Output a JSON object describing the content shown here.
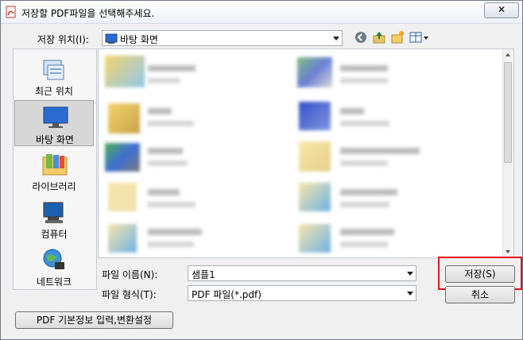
{
  "title": "저장할 PDF파일을 선택해주세요.",
  "close_glyph": "✕",
  "location": {
    "label": "저장 위치(I):",
    "value": "바탕 화면"
  },
  "places": [
    {
      "label": "최근 위치"
    },
    {
      "label": "바탕 화면"
    },
    {
      "label": "라이브러리"
    },
    {
      "label": "컴퓨터"
    },
    {
      "label": "네트워크"
    }
  ],
  "filename": {
    "label": "파일 이름(N):",
    "value": "샘플1"
  },
  "filetype": {
    "label": "파일 형식(T):",
    "value": "PDF 파일(*.pdf)"
  },
  "buttons": {
    "save": "저장(S)",
    "cancel": "취소",
    "pdf_settings": "PDF 기본정보 입력,변환설정"
  },
  "colors": {
    "highlight": "#e5141b",
    "selected_place": "#d7d7d7"
  }
}
